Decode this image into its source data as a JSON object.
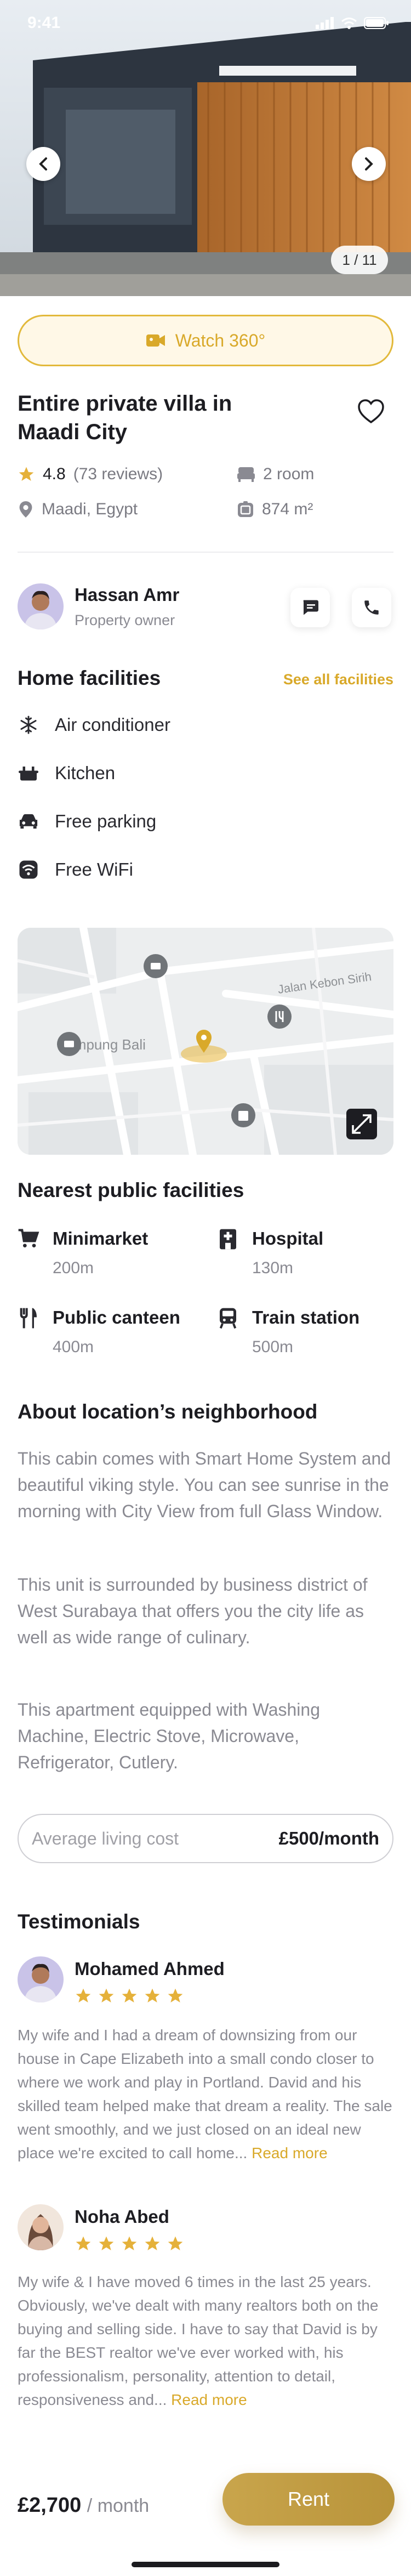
{
  "status_bar": {
    "time": "9:41"
  },
  "gallery": {
    "counter": "1 / 11"
  },
  "watch_label": "Watch 360°",
  "listing": {
    "title": "Entire private villa in Maadi City",
    "rating": "4.8",
    "reviews": "(73 reviews)",
    "rooms": "2 room",
    "location": "Maadi, Egypt",
    "area": "874 m²"
  },
  "owner": {
    "name": "Hassan Amr",
    "role": "Property owner"
  },
  "facilities": {
    "title": "Home facilities",
    "see_all": "See all facilities",
    "items": [
      {
        "label": "Air conditioner",
        "icon": "snowflake-icon"
      },
      {
        "label": "Kitchen",
        "icon": "kitchen-icon"
      },
      {
        "label": "Free parking",
        "icon": "car-icon"
      },
      {
        "label": "Free WiFi",
        "icon": "wifi-icon"
      }
    ]
  },
  "map": {
    "street_label": "Jalan Kebon Sirih",
    "area_label": "Kampung Bali"
  },
  "public_facilities": {
    "title": "Nearest public facilities",
    "items": [
      {
        "name": "Minimarket",
        "distance": "200m",
        "icon": "cart-icon"
      },
      {
        "name": "Hospital",
        "distance": "130m",
        "icon": "hospital-icon"
      },
      {
        "name": "Public canteen",
        "distance": "400m",
        "icon": "fork-icon"
      },
      {
        "name": "Train station",
        "distance": "500m",
        "icon": "train-icon"
      }
    ]
  },
  "about": {
    "title": "About location’s neighborhood",
    "paragraphs": [
      "This cabin comes with Smart Home System and beautiful viking style. You can see sunrise in the morning with City View from full Glass Window.",
      "This unit is surrounded by business district of West Surabaya that offers you the city life as well as wide range of culinary.",
      "This apartment equipped with Washing Machine, Electric Stove, Microwave, Refrigerator, Cutlery."
    ]
  },
  "living_cost": {
    "label": "Average living cost",
    "value": "£500/month"
  },
  "testimonials": {
    "title": "Testimonials",
    "items": [
      {
        "name": "Mohamed Ahmed",
        "rating": 5,
        "text": "My wife and I had a dream of downsizing from our house in Cape Elizabeth into a small condo closer to where we work and play in Portland. David and his skilled team helped make that dream a reality. The sale went smoothly, and we just closed on an ideal new place we're excited to call home...",
        "more": "Read more"
      },
      {
        "name": "Noha Abed",
        "rating": 5,
        "text": "My wife & I have moved 6 times in the last 25 years. Obviously, we've dealt with many realtors both on the buying and selling side. I have to say that David is by far the BEST realtor we've ever worked with, his professionalism, personality, attention to detail, responsiveness and...",
        "more": "Read more"
      }
    ]
  },
  "footer": {
    "price": "£2,700",
    "period": "/ month",
    "cta": "Rent"
  },
  "colors": {
    "accent": "#d9a92a",
    "accent_bg": "#fff8e7",
    "text": "#1d1d22",
    "muted": "#8a8a92"
  }
}
